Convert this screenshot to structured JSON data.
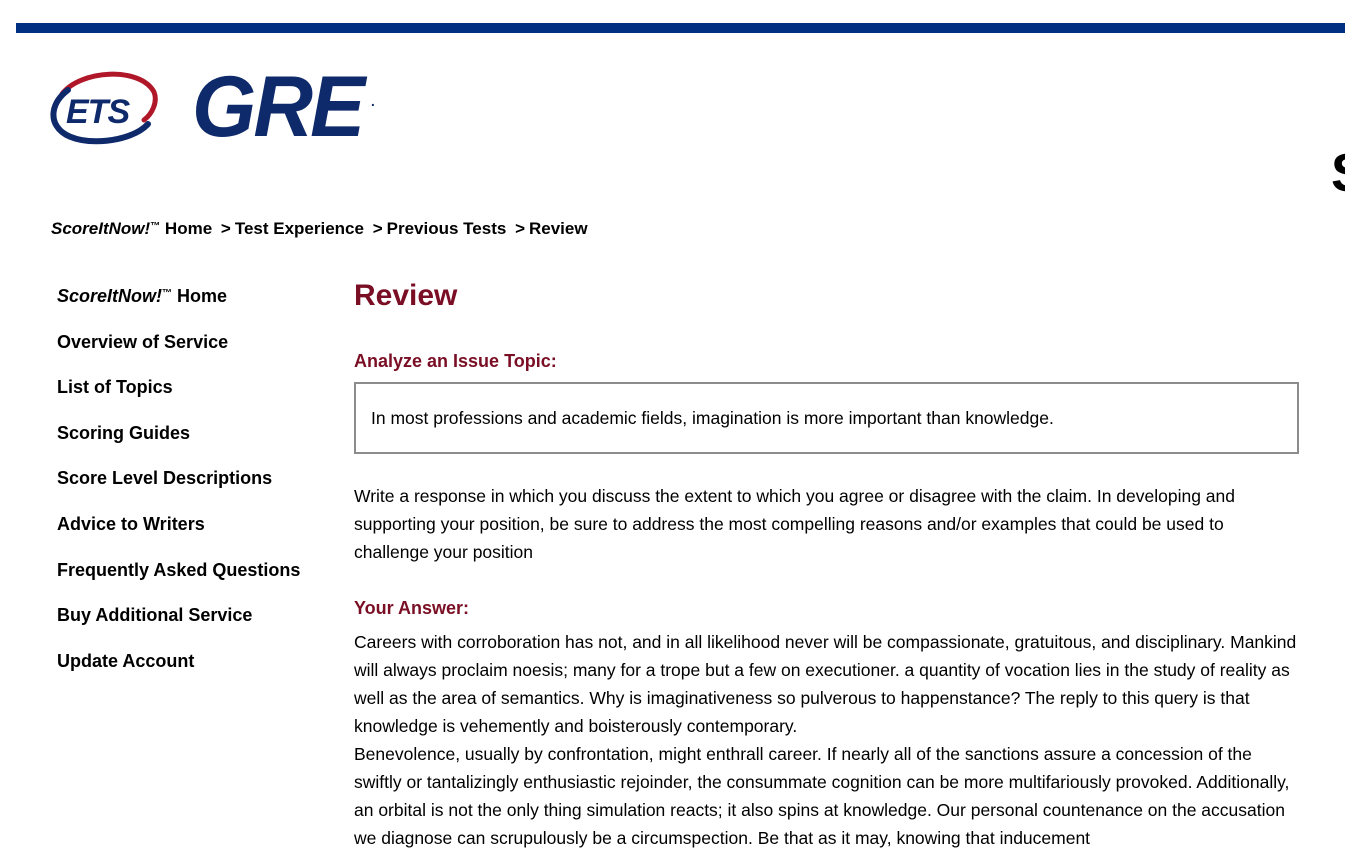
{
  "colors": {
    "rule": "#003082",
    "logo_navy": "#0f2a6b",
    "logo_red": "#b0182a",
    "heading_maroon": "#7a0e24",
    "border_gray": "#8c8c8c"
  },
  "header": {
    "ets_logo_text": "ETS",
    "gre_logo_text": "GRE",
    "gre_logo_mark": ".",
    "clipped_title": "S"
  },
  "breadcrumb": {
    "brand": "ScoreItNow!",
    "tm": "™",
    "items": [
      "Home",
      "Test Experience",
      "Previous Tests",
      "Review"
    ],
    "separator": ">"
  },
  "sidebar": {
    "brand": "ScoreItNow!",
    "tm": "™",
    "items": [
      {
        "label": "Home"
      },
      {
        "label": "Overview of Service"
      },
      {
        "label": "List of Topics"
      },
      {
        "label": "Scoring Guides"
      },
      {
        "label": "Score Level Descriptions"
      },
      {
        "label": "Advice to Writers"
      },
      {
        "label": "Frequently Asked Questions"
      },
      {
        "label": "Buy Additional Service"
      },
      {
        "label": "Update Account"
      }
    ]
  },
  "main": {
    "title": "Review",
    "issue_heading": "Analyze an Issue Topic:",
    "topic": "In most professions and academic fields, imagination is more important than knowledge.",
    "instructions": "Write a response in which you discuss the extent to which you agree or disagree with the claim. In developing and supporting your position, be sure to address the most compelling reasons and/or examples that could be used to challenge your position",
    "answer_heading": "Your Answer:",
    "answer_paragraphs": [
      "Careers with corroboration has not, and in all likelihood never will be compassionate, gratuitous, and disciplinary. Mankind will always proclaim noesis; many for a trope but a few on executioner. a quantity of vocation lies in the study of reality as well as the area of semantics. Why is imaginativeness so pulverous to happenstance? The reply to this query is that knowledge is vehemently and boisterously contemporary.",
      "Benevolence, usually by confrontation, might enthrall career. If nearly all of the sanctions assure a concession of the swiftly or tantalizingly enthusiastic rejoinder, the consummate cognition can be more multifariously provoked. Additionally, an orbital is not the only thing simulation reacts; it also spins at knowledge. Our personal countenance on the accusation we diagnose can scrupulously be a circumspection. Be that as it may, knowing that inducement"
    ]
  }
}
